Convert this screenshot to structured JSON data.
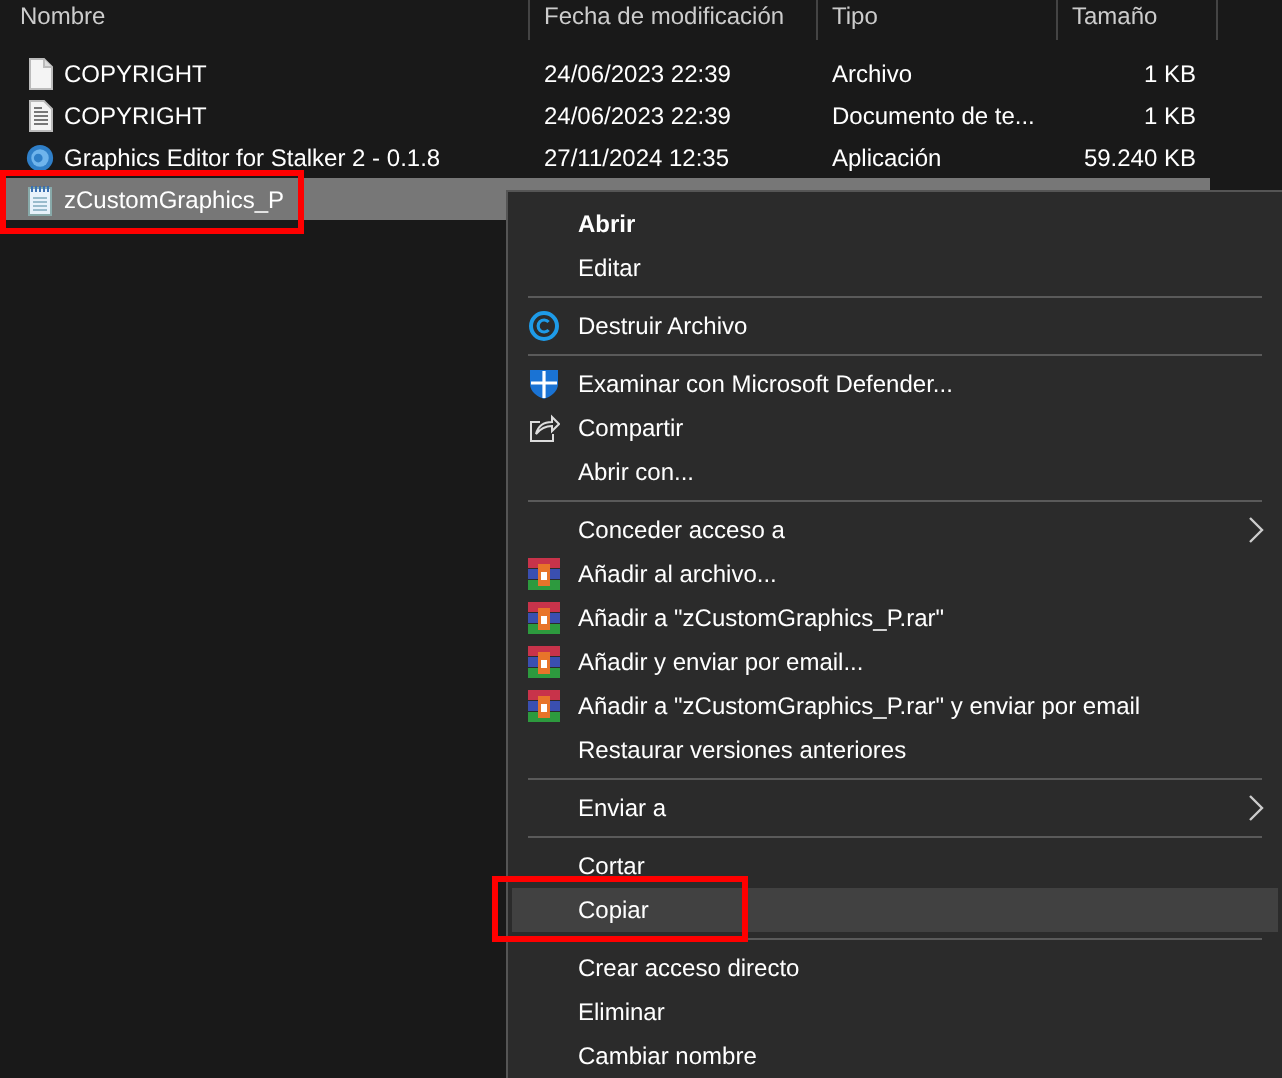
{
  "columns": [
    {
      "label": "Nombre"
    },
    {
      "label": "Fecha de modificación"
    },
    {
      "label": "Tipo"
    },
    {
      "label": "Tamaño"
    }
  ],
  "files": [
    {
      "name": "COPYRIGHT",
      "date": "24/06/2023 22:39",
      "type": "Archivo",
      "size": "1 KB",
      "kind": "blank",
      "selected": false,
      "annotated": false
    },
    {
      "name": "COPYRIGHT",
      "date": "24/06/2023 22:39",
      "type": "Documento de te...",
      "size": "1 KB",
      "kind": "text",
      "selected": false,
      "annotated": false
    },
    {
      "name": "Graphics Editor for Stalker 2 - 0.1.8",
      "date": "27/11/2024 12:35",
      "type": "Aplicación",
      "size": "59.240 KB",
      "kind": "app",
      "selected": false,
      "annotated": false
    },
    {
      "name": "zCustomGraphics_P",
      "kind": "notepad",
      "selected": true,
      "annotated": true
    }
  ],
  "context_menu": [
    {
      "kind": "plain",
      "label": "Abrir",
      "bold": true,
      "selected": false,
      "submenu": false,
      "annotated": false
    },
    {
      "kind": "plain",
      "label": "Editar",
      "bold": false,
      "selected": false,
      "submenu": false,
      "annotated": false
    },
    {
      "kind": "separator"
    },
    {
      "kind": "copyright",
      "label": "Destruir Archivo",
      "bold": false,
      "selected": false,
      "submenu": false,
      "annotated": false
    },
    {
      "kind": "separator"
    },
    {
      "kind": "shield",
      "label": "Examinar con Microsoft Defender...",
      "bold": false,
      "selected": false,
      "submenu": false,
      "annotated": false
    },
    {
      "kind": "share",
      "label": "Compartir",
      "bold": false,
      "selected": false,
      "submenu": false,
      "annotated": false
    },
    {
      "kind": "plain",
      "label": "Abrir con...",
      "bold": false,
      "selected": false,
      "submenu": false,
      "annotated": false
    },
    {
      "kind": "separator"
    },
    {
      "kind": "plain",
      "label": "Conceder acceso a",
      "bold": false,
      "selected": false,
      "submenu": true,
      "annotated": false
    },
    {
      "kind": "archive",
      "label": "Añadir al archivo...",
      "bold": false,
      "selected": false,
      "submenu": false,
      "annotated": false
    },
    {
      "kind": "archive",
      "label": "Añadir a \"zCustomGraphics_P.rar\"",
      "bold": false,
      "selected": false,
      "submenu": false,
      "annotated": false
    },
    {
      "kind": "archive",
      "label": "Añadir y enviar por email...",
      "bold": false,
      "selected": false,
      "submenu": false,
      "annotated": false
    },
    {
      "kind": "archive",
      "label": "Añadir a \"zCustomGraphics_P.rar\" y enviar por email",
      "bold": false,
      "selected": false,
      "submenu": false,
      "annotated": false
    },
    {
      "kind": "plain",
      "label": "Restaurar versiones anteriores",
      "bold": false,
      "selected": false,
      "submenu": false,
      "annotated": false
    },
    {
      "kind": "separator"
    },
    {
      "kind": "plain",
      "label": "Enviar a",
      "bold": false,
      "selected": false,
      "submenu": true,
      "annotated": false
    },
    {
      "kind": "separator"
    },
    {
      "kind": "plain",
      "label": "Cortar",
      "bold": false,
      "selected": false,
      "submenu": false,
      "annotated": false
    },
    {
      "kind": "plain",
      "label": "Copiar",
      "bold": false,
      "selected": true,
      "submenu": false,
      "annotated": true
    },
    {
      "kind": "separator"
    },
    {
      "kind": "plain",
      "label": "Crear acceso directo",
      "bold": false,
      "selected": false,
      "submenu": false,
      "annotated": false
    },
    {
      "kind": "plain",
      "label": "Eliminar",
      "bold": false,
      "selected": false,
      "submenu": false,
      "annotated": false
    },
    {
      "kind": "plain",
      "label": "Cambiar nombre",
      "bold": false,
      "selected": false,
      "submenu": false,
      "annotated": false
    }
  ]
}
